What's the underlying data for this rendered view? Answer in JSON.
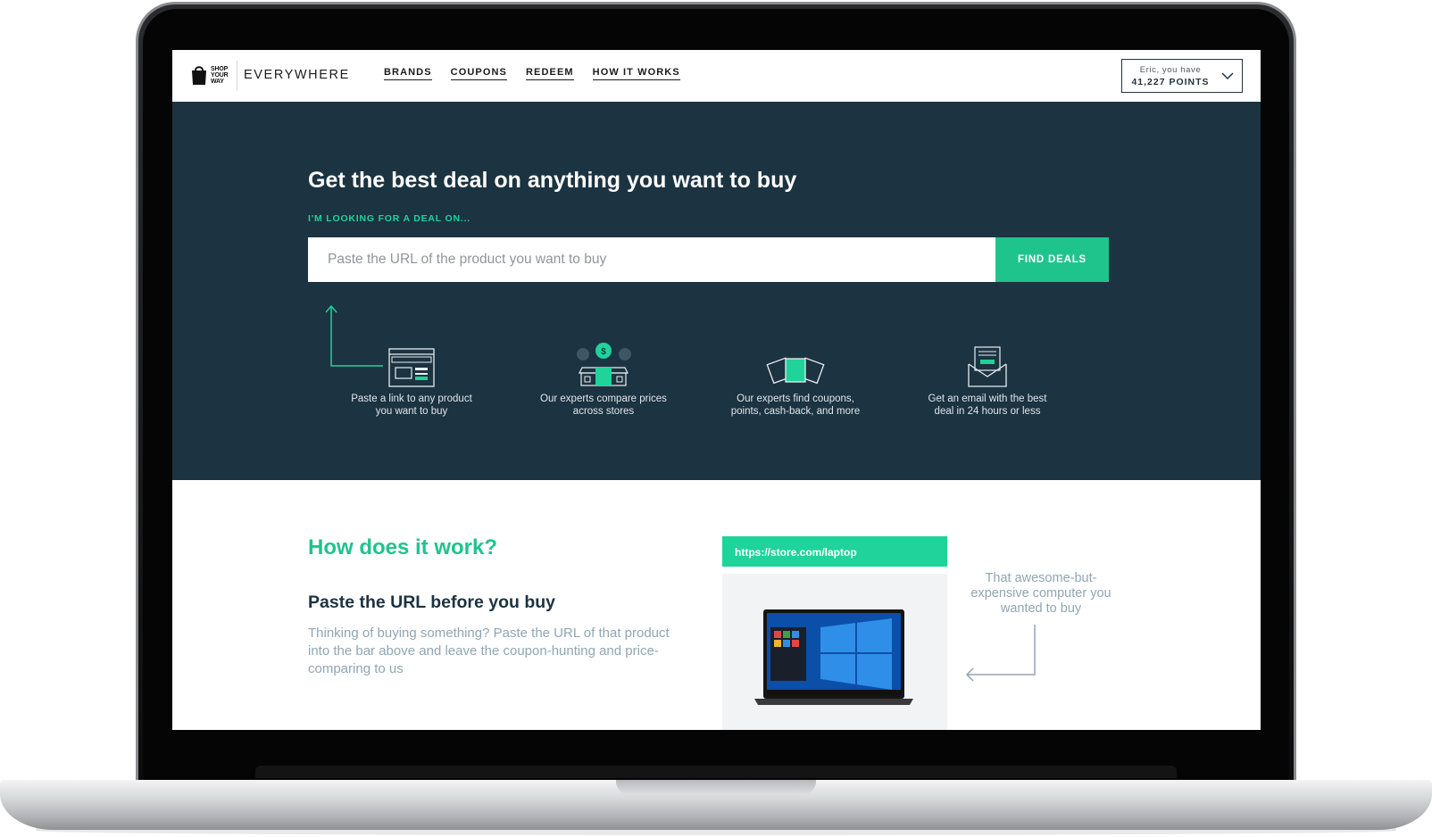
{
  "logo": {
    "shop_your_way": "SHOP YOUR WAY",
    "everywhere": "EVERYWHERE"
  },
  "nav": {
    "links": [
      "BRANDS",
      "COUPONS",
      "REDEEM",
      "HOW IT WORKS"
    ]
  },
  "account": {
    "greeting": "Eric, you have",
    "points": "41,227 POINTS"
  },
  "hero": {
    "title": "Get the best deal on anything you want to buy",
    "subtitle": "I'M LOOKING FOR A DEAL ON...",
    "search_placeholder": "Paste the URL of the product you want to buy",
    "button": "FIND DEALS",
    "steps": [
      {
        "icon": "browser-link-icon",
        "line1": "Paste a link to any product",
        "line2": "you want to buy"
      },
      {
        "icon": "store-compare-icon",
        "line1": "Our experts compare prices",
        "line2": "across stores"
      },
      {
        "icon": "coupon-tags-icon",
        "line1": "Our experts find coupons,",
        "line2": "points, cash-back, and more"
      },
      {
        "icon": "email-envelope-icon",
        "line1": "Get an email with the best",
        "line2": "deal in 24 hours or less"
      }
    ]
  },
  "how": {
    "title": "How does it work?",
    "subtitle": "Paste the URL before you buy",
    "description": "Thinking of buying something? Paste the URL of that product into the bar above and leave the coupon-hunting and price-comparing to us",
    "url_example": "https://store.com/laptop",
    "annotation": "That awesome-but-expensive computer you wanted to buy"
  },
  "colors": {
    "hero_bg": "#1c3341",
    "accent": "#1fc48d",
    "muted_text": "#8fa6b4"
  }
}
